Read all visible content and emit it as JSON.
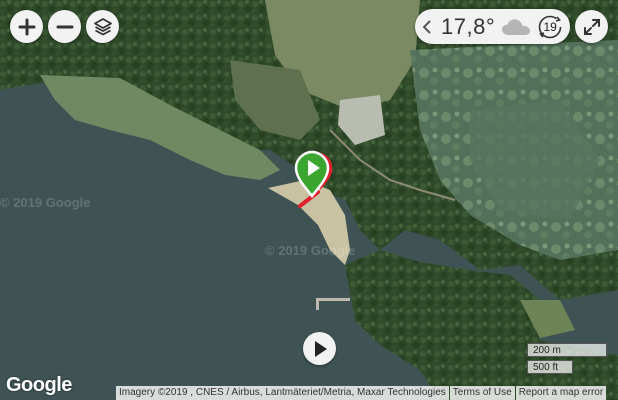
{
  "controls": {
    "zoom_in_icon": "plus-icon",
    "zoom_out_icon": "minus-icon",
    "layers_icon": "layers-icon",
    "fullscreen_icon": "expand-icon"
  },
  "weather": {
    "temperature": "17,8°",
    "condition_icon": "cloud-icon",
    "hour": "19"
  },
  "marker": {
    "icon": "play-marker-icon",
    "color": "#3aa62f",
    "accent_color": "#e0202e"
  },
  "watermarks": [
    "© 2019 Google",
    "© 2019 Google"
  ],
  "scale": {
    "metric": "200 m",
    "imperial": "500 ft"
  },
  "footer": {
    "logo": "Google",
    "imagery": "Imagery ©2019 , CNES / Airbus, Lantmäteriet/Metria, Maxar Technologies",
    "terms": "Terms of Use",
    "report": "Report a map error"
  }
}
